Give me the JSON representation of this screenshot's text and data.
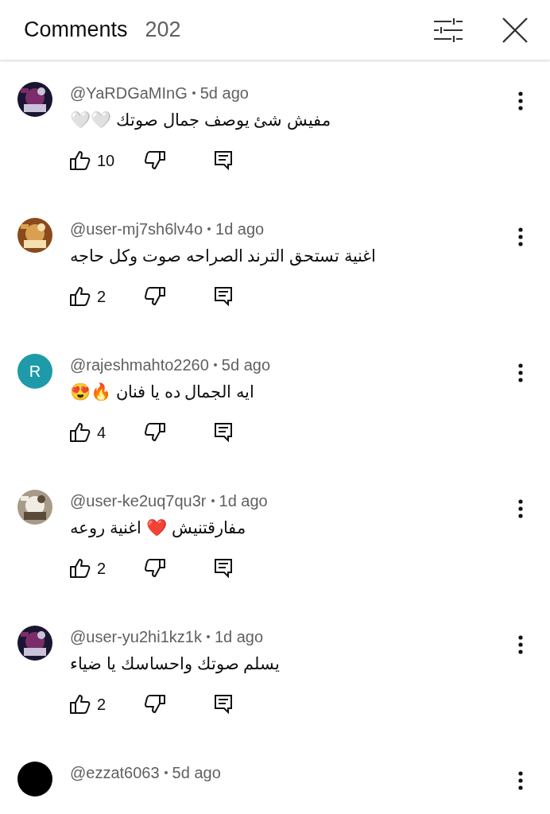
{
  "header": {
    "title": "Comments",
    "count": "202"
  },
  "comments": [
    {
      "author": "@YaRDGaMInG",
      "time": "5d ago",
      "text": "مفيش شئ يوصف جمال صوتك 🤍🤍",
      "likes": "10"
    },
    {
      "author": "@user-mj7sh6lv4o",
      "time": "1d ago",
      "text": "اغنية تستحق الترند الصراحه صوت وكل حاجه",
      "likes": "2"
    },
    {
      "author": "@rajeshmahto2260",
      "time": "5d ago",
      "text": "ايه الجمال ده يا فنان 🔥😍",
      "likes": "4",
      "avatar": {
        "kind": "letter",
        "letter": "R",
        "color": "#1e9aa8"
      }
    },
    {
      "author": "@user-ke2uq7qu3r",
      "time": "1d ago",
      "text": "مفارقتنيش ❤️ اغنية روعه",
      "likes": "2"
    },
    {
      "author": "@user-yu2hi1kz1k",
      "time": "1d ago",
      "text": "يسلم صوتك واحساسك يا ضياء",
      "likes": "2"
    },
    {
      "author": "@ezzat6063",
      "time": "5d ago",
      "avatar": {
        "kind": "plain",
        "color": "#000000"
      }
    }
  ]
}
